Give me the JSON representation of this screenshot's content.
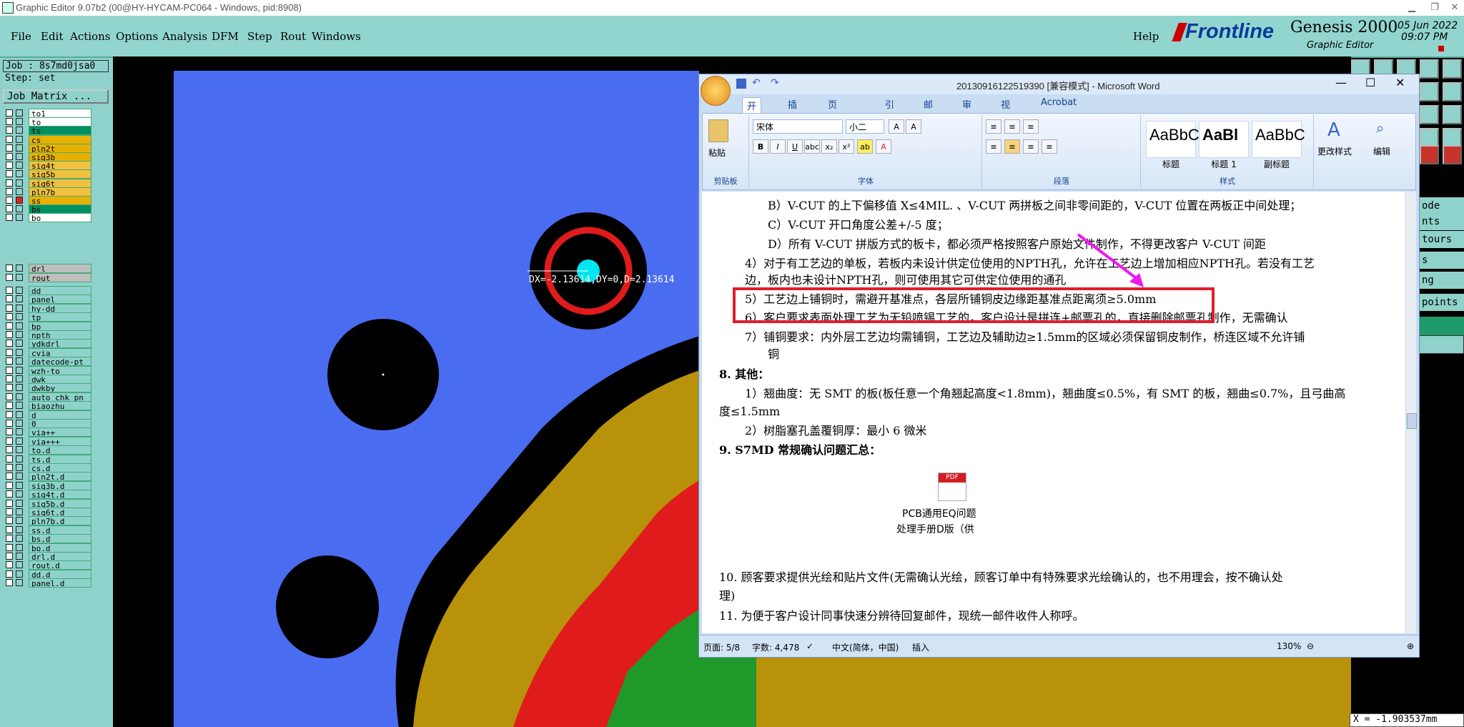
{
  "window": {
    "title": "Graphic Editor 9.07b2 (00@HY-HYCAM-PC064 - Windows, pid:8908)"
  },
  "menubar": {
    "items": [
      "File",
      "Edit",
      "Actions",
      "Options",
      "Analysis",
      "DFM",
      "Step",
      "Rout",
      "Windows"
    ],
    "help": "Help"
  },
  "brand": {
    "logo": "Frontline",
    "product": "Genesis 2000",
    "subtitle": "Graphic Editor",
    "date": "05 Jun 2022",
    "time": "09:07 PM"
  },
  "job": {
    "job_label": "Job : 8s7md0jsa0",
    "step_label": "Step: set",
    "matrix_button": "Job Matrix ..."
  },
  "layers": [
    {
      "name": "to1",
      "color": "#ffffff"
    },
    {
      "name": "to",
      "color": "#ffffff"
    },
    {
      "name": "ts",
      "color": "#009060"
    },
    {
      "name": "cs",
      "color": "#e8b000"
    },
    {
      "name": "pln2t",
      "color": "#e8b000"
    },
    {
      "name": "sig3b",
      "color": "#e8b000"
    },
    {
      "name": "sig4t",
      "color": "#f0c040"
    },
    {
      "name": "sig5b",
      "color": "#f0c040"
    },
    {
      "name": "sig6t",
      "color": "#f0c040"
    },
    {
      "name": "pln7b",
      "color": "#f0c040"
    },
    {
      "name": "ss",
      "color": "#e8b000"
    },
    {
      "name": "bs",
      "color": "#009060"
    },
    {
      "name": "bo",
      "color": "#ffffff"
    },
    {
      "name": "drl",
      "color": "#bfbfbf"
    },
    {
      "name": "rout",
      "color": "#bfbfbf"
    },
    {
      "name": "dd",
      "color": "#8fd2cb"
    },
    {
      "name": "panel",
      "color": "#8fd2cb"
    },
    {
      "name": "hy-dd",
      "color": "#8fd2cb"
    },
    {
      "name": "tp",
      "color": "#8fd2cb"
    },
    {
      "name": "bp",
      "color": "#8fd2cb"
    },
    {
      "name": "npth",
      "color": "#8fd2cb"
    },
    {
      "name": "ydkdrl",
      "color": "#8fd2cb"
    },
    {
      "name": "cvia",
      "color": "#8fd2cb"
    },
    {
      "name": "datecode-pt",
      "color": "#8fd2cb"
    },
    {
      "name": "wzh-to",
      "color": "#8fd2cb"
    },
    {
      "name": "dwk",
      "color": "#8fd2cb"
    },
    {
      "name": "dwkby",
      "color": "#8fd2cb"
    },
    {
      "name": "auto_chk_pn",
      "color": "#8fd2cb"
    },
    {
      "name": "biaozhu",
      "color": "#8fd2cb"
    },
    {
      "name": "d",
      "color": "#8fd2cb"
    },
    {
      "name": "0",
      "color": "#8fd2cb"
    },
    {
      "name": "via++",
      "color": "#8fd2cb"
    },
    {
      "name": "via+++",
      "color": "#8fd2cb"
    },
    {
      "name": "to.d",
      "color": "#8fd2cb"
    },
    {
      "name": "ts.d",
      "color": "#8fd2cb"
    },
    {
      "name": "cs.d",
      "color": "#8fd2cb"
    },
    {
      "name": "pln2t.d",
      "color": "#8fd2cb"
    },
    {
      "name": "sig3b.d",
      "color": "#8fd2cb"
    },
    {
      "name": "sig4t.d",
      "color": "#8fd2cb"
    },
    {
      "name": "sig5b.d",
      "color": "#8fd2cb"
    },
    {
      "name": "sig6t.d",
      "color": "#8fd2cb"
    },
    {
      "name": "pln7b.d",
      "color": "#8fd2cb"
    },
    {
      "name": "ss.d",
      "color": "#8fd2cb"
    },
    {
      "name": "bs.d",
      "color": "#8fd2cb"
    },
    {
      "name": "bo.d",
      "color": "#8fd2cb"
    },
    {
      "name": "drl.d",
      "color": "#8fd2cb"
    },
    {
      "name": "rout.d",
      "color": "#8fd2cb"
    },
    {
      "name": "dd.d",
      "color": "#8fd2cb"
    },
    {
      "name": "panel.d",
      "color": "#8fd2cb"
    }
  ],
  "canvas": {
    "measure_readout": "DX=-2.13614,DY=0,D=2.13614",
    "coord_readout": "X = -1.903537mm"
  },
  "right_menu": [
    "ode",
    "nts",
    "tours",
    "s",
    "ng",
    "points"
  ],
  "word": {
    "title": "20130916122519390 [兼容模式] - Microsoft Word",
    "tabs": [
      "开始",
      "插入",
      "页面布局",
      "引用",
      "邮件",
      "审阅",
      "视图",
      "Acrobat"
    ],
    "clipboard": {
      "paste": "粘贴",
      "label": "剪贴板"
    },
    "font": {
      "name": "宋体",
      "size": "小二",
      "label": "字体"
    },
    "paragraph_label": "段落",
    "styles": [
      {
        "preview": "AaBbC",
        "name": "标题"
      },
      {
        "preview": "AaBl",
        "name": "标题 1"
      },
      {
        "preview": "AaBbC",
        "name": "副标题"
      }
    ],
    "styles_label": "样式",
    "change_styles": "更改样式",
    "edit": "编辑",
    "doc_lines": [
      "B）V-CUT 的上下偏移值 X≤4MIL. 、V-CUT 两拼板之间非零间距的，V-CUT 位置在两板正中间处理；",
      "C）V-CUT 开口角度公差+/-5 度；",
      "D）所有 V-CUT 拼版方式的板卡，都必须严格按照客户原始文件制作，不得更改客户 V-CUT 间距",
      "4）对于有工艺边的单板，若板内未设计供定位使用的NPTH孔，允许在工艺边上增加相应NPTH孔。若没有工艺",
      "边，板内也未设计NPTH孔，则可使用其它可供定位使用的通孔",
      "5）工艺边上铺铜时，需避开基准点，各层所铺铜皮边缘距基准点距离须≥5.0mm",
      "6）客户要求表面处理工艺为无铅喷锡工艺的，客户设计是拼连+邮票孔的，直接删除邮票孔制作，无需确认",
      "7）铺铜要求：内外层工艺边均需铺铜，工艺边及辅助边≥1.5mm的区域必须保留铜皮制作，桥连区域不允许铺",
      "铜",
      "8.  其他：",
      "1）翘曲度：无 SMT 的板(板任意一个角翘起高度<1.8mm)，翘曲度≤0.5%，有 SMT 的板，翘曲≤0.7%，且弓曲高",
      "度≤1.5mm",
      "2）树脂塞孔盖覆铜厚：最小 6 微米",
      "9.  S7MD 常规确认问题汇总：",
      "10. 顾客要求提供光绘和贴片文件(无需确认光绘，顾客订单中有特殊要求光绘确认的，也不用理会，按不确认处",
      "理)",
      "11. 为便于客户设计同事快速分辨待回复邮件，现统一邮件收件人称呼。"
    ],
    "attachment": {
      "icon": "PDF",
      "caption1": "PCB通用EQ问题",
      "caption2": "处理手册D版（供"
    },
    "status": {
      "page": "页面: 5/8",
      "words": "字数: 4,478",
      "lang": "中文(简体，中国)",
      "insert": "插入",
      "zoom": "130%"
    }
  }
}
